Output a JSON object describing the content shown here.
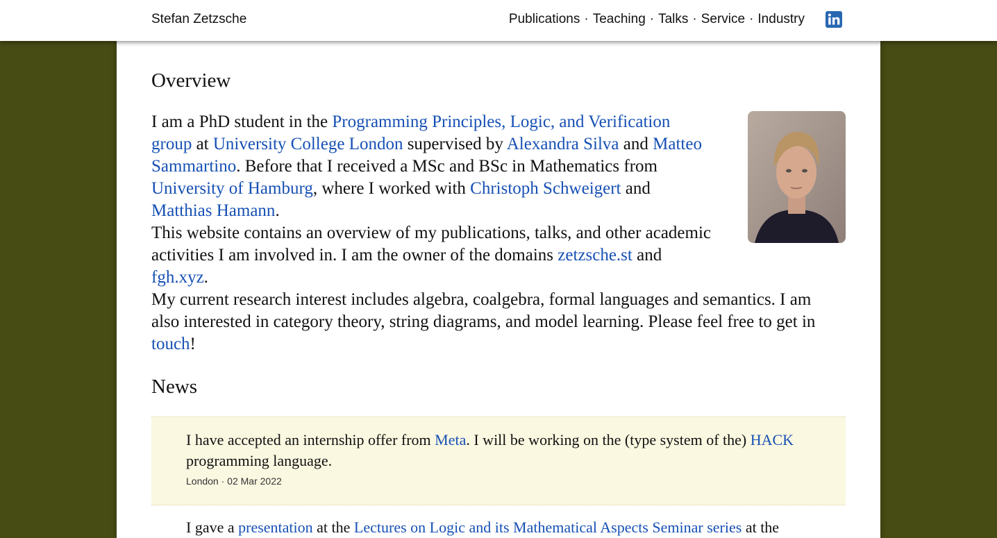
{
  "header": {
    "site_name": "Stefan Zetzsche",
    "nav": [
      "Publications",
      "Teaching",
      "Talks",
      "Service",
      "Industry"
    ],
    "nav_separator": "·",
    "linkedin_icon": "linkedin-icon"
  },
  "overview": {
    "title": "Overview",
    "p1": {
      "t1": "I am a PhD student in the ",
      "l1": "Programming Principles, Logic, and Verification group",
      "t2": " at ",
      "l2": "University College London",
      "t3": " supervised by ",
      "l3": "Alexandra Silva",
      "t4": " and ",
      "l4": "Matteo Sammartino",
      "t5": ". Before that I received a MSc and BSc in Mathematics from ",
      "l5": "University of Hamburg",
      "t6": ", where I worked with ",
      "l6": "Christoph Schweigert",
      "t7": " and ",
      "l7": "Matthias Hamann",
      "t8": "."
    },
    "p2": {
      "t1": "This website contains an overview of my publications, talks, and other academic activities I am involved in. I am the owner of the domains ",
      "l1": "zetzsche.st",
      "t2": " and ",
      "l2": "fgh.xyz",
      "t3": "."
    },
    "p3": {
      "t1": "My current research interest includes algebra, coalgebra, formal languages and semantics. I am also interested in category theory, string diagrams, and model learning. Please feel free to get in ",
      "l1": "touch",
      "t2": "!"
    }
  },
  "news": {
    "title": "News",
    "items": [
      {
        "t1": "I have accepted an internship offer from ",
        "l1": "Meta",
        "t2": ". I will be working on the (type system of the) ",
        "l2": "HACK",
        "t3": " programming language.",
        "meta": "London · 02 Mar 2022"
      },
      {
        "t1": "I gave a ",
        "l1": "presentation",
        "t2": " at the ",
        "l2": "Lectures on Logic and its Mathematical Aspects Seminar series",
        "t3": " at the"
      }
    ]
  },
  "colors": {
    "background": "#474b14",
    "link": "#1650b4",
    "news_highlight": "#fbf8e1",
    "linkedin": "#2867b2"
  }
}
